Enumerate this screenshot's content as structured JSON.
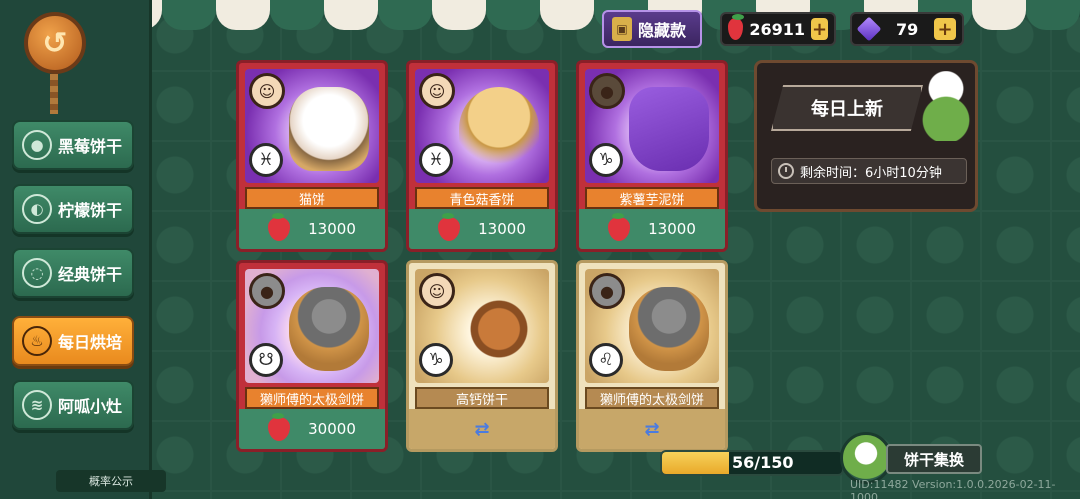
{
  "currency": {
    "hidden_label": "隐藏款",
    "strawberry_count": "26911",
    "gem_count": "79"
  },
  "sidebar": {
    "items": [
      {
        "label": "黑莓饼干",
        "icon": "blackberry-icon",
        "active": false
      },
      {
        "label": "柠檬饼干",
        "icon": "lemon-icon",
        "active": false
      },
      {
        "label": "经典饼干",
        "icon": "cookie-icon",
        "active": false
      },
      {
        "label": "每日烘培",
        "icon": "bakery-icon",
        "active": true
      },
      {
        "label": "阿呱小灶",
        "icon": "stove-icon",
        "active": false
      }
    ],
    "probability": "概率公示"
  },
  "daily_panel": {
    "title": "每日上新",
    "timer_label": "剩余时间：6小时10分钟"
  },
  "cards": [
    {
      "name": "猫饼",
      "price": "13000",
      "sign": "♓",
      "style": "red",
      "art": "purple",
      "item": "cat",
      "paid": true
    },
    {
      "name": "青色菇香饼",
      "price": "13000",
      "sign": "♓",
      "style": "red",
      "art": "purple",
      "item": "mush",
      "paid": true
    },
    {
      "name": "紫薯芋泥饼",
      "price": "13000",
      "sign": "♑",
      "style": "red",
      "art": "purple",
      "item": "taro",
      "paid": true
    },
    {
      "name": "獭师傅的太极剑饼",
      "price": "30000",
      "sign": "☋",
      "style": "red",
      "art": "rainbow",
      "item": "otter",
      "paid": true
    },
    {
      "name": "高钙饼干",
      "price": "",
      "sign": "♑",
      "style": "cream",
      "art": "cream",
      "item": "plate",
      "paid": false
    },
    {
      "name": "獭师傅的太极剑饼",
      "price": "",
      "sign": "♌",
      "style": "cream",
      "art": "cream",
      "item": "otter",
      "paid": false
    }
  ],
  "progress": {
    "label": "56/150",
    "fraction": 0.373
  },
  "exchange": {
    "label": "饼干集换"
  },
  "version": "UID:11482 Version:1.0.0.2026-02-11-1000",
  "colors": {
    "accent_orange": "#e98a1e",
    "green": "#3f8a68",
    "red_card": "#c0303a",
    "cream_card": "#efe2bd"
  }
}
